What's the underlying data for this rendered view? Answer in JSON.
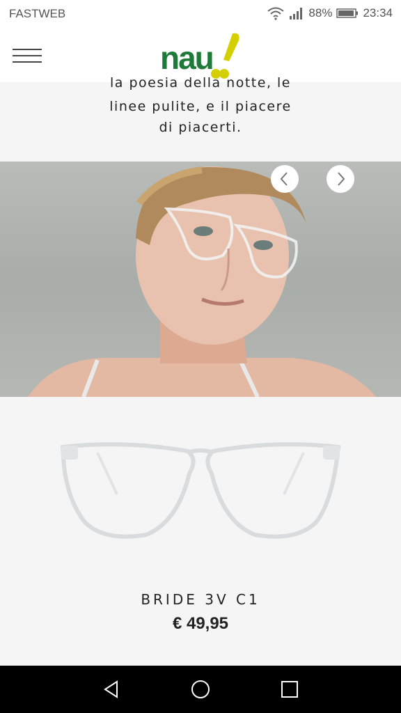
{
  "status_bar": {
    "carrier": "FASTWEB",
    "battery": "88%",
    "time": "23:34"
  },
  "header": {
    "logo_text": "nau",
    "brand_colors": {
      "green": "#1f7a3a",
      "yellow": "#d4d000"
    }
  },
  "intro": {
    "lines": [
      "la poesia della notte, le",
      "linee pulite, e il piacere",
      "di piacerti."
    ]
  },
  "carousel": {
    "prev_icon": "chevron-left-icon",
    "next_icon": "chevron-right-icon"
  },
  "product": {
    "name": "BRIDE 3V C1",
    "price": "€ 49,95"
  },
  "nav_bar": {
    "icons": [
      "back-triangle-icon",
      "home-circle-icon",
      "recents-square-icon"
    ]
  }
}
